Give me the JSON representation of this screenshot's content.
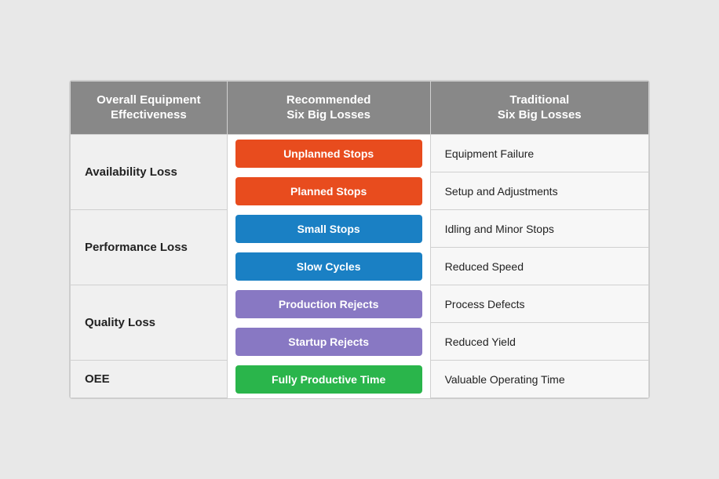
{
  "header": {
    "col1": "Overall Equipment\nEffectiveness",
    "col2": "Recommended\nSix Big Losses",
    "col3": "Traditional\nSix Big Losses"
  },
  "rows": [
    {
      "category": "Availability Loss",
      "items": [
        {
          "label": "Unplanned Stops",
          "color": "orange",
          "traditional": "Equipment Failure"
        },
        {
          "label": "Planned Stops",
          "color": "orange",
          "traditional": "Setup and Adjustments"
        }
      ]
    },
    {
      "category": "Performance Loss",
      "items": [
        {
          "label": "Small Stops",
          "color": "blue",
          "traditional": "Idling and Minor Stops"
        },
        {
          "label": "Slow Cycles",
          "color": "blue",
          "traditional": "Reduced Speed"
        }
      ]
    },
    {
      "category": "Quality Loss",
      "items": [
        {
          "label": "Production Rejects",
          "color": "purple",
          "traditional": "Process Defects"
        },
        {
          "label": "Startup Rejects",
          "color": "purple",
          "traditional": "Reduced Yield"
        }
      ]
    },
    {
      "category": "OEE",
      "items": [
        {
          "label": "Fully Productive Time",
          "color": "green",
          "traditional": "Valuable Operating Time"
        }
      ]
    }
  ]
}
